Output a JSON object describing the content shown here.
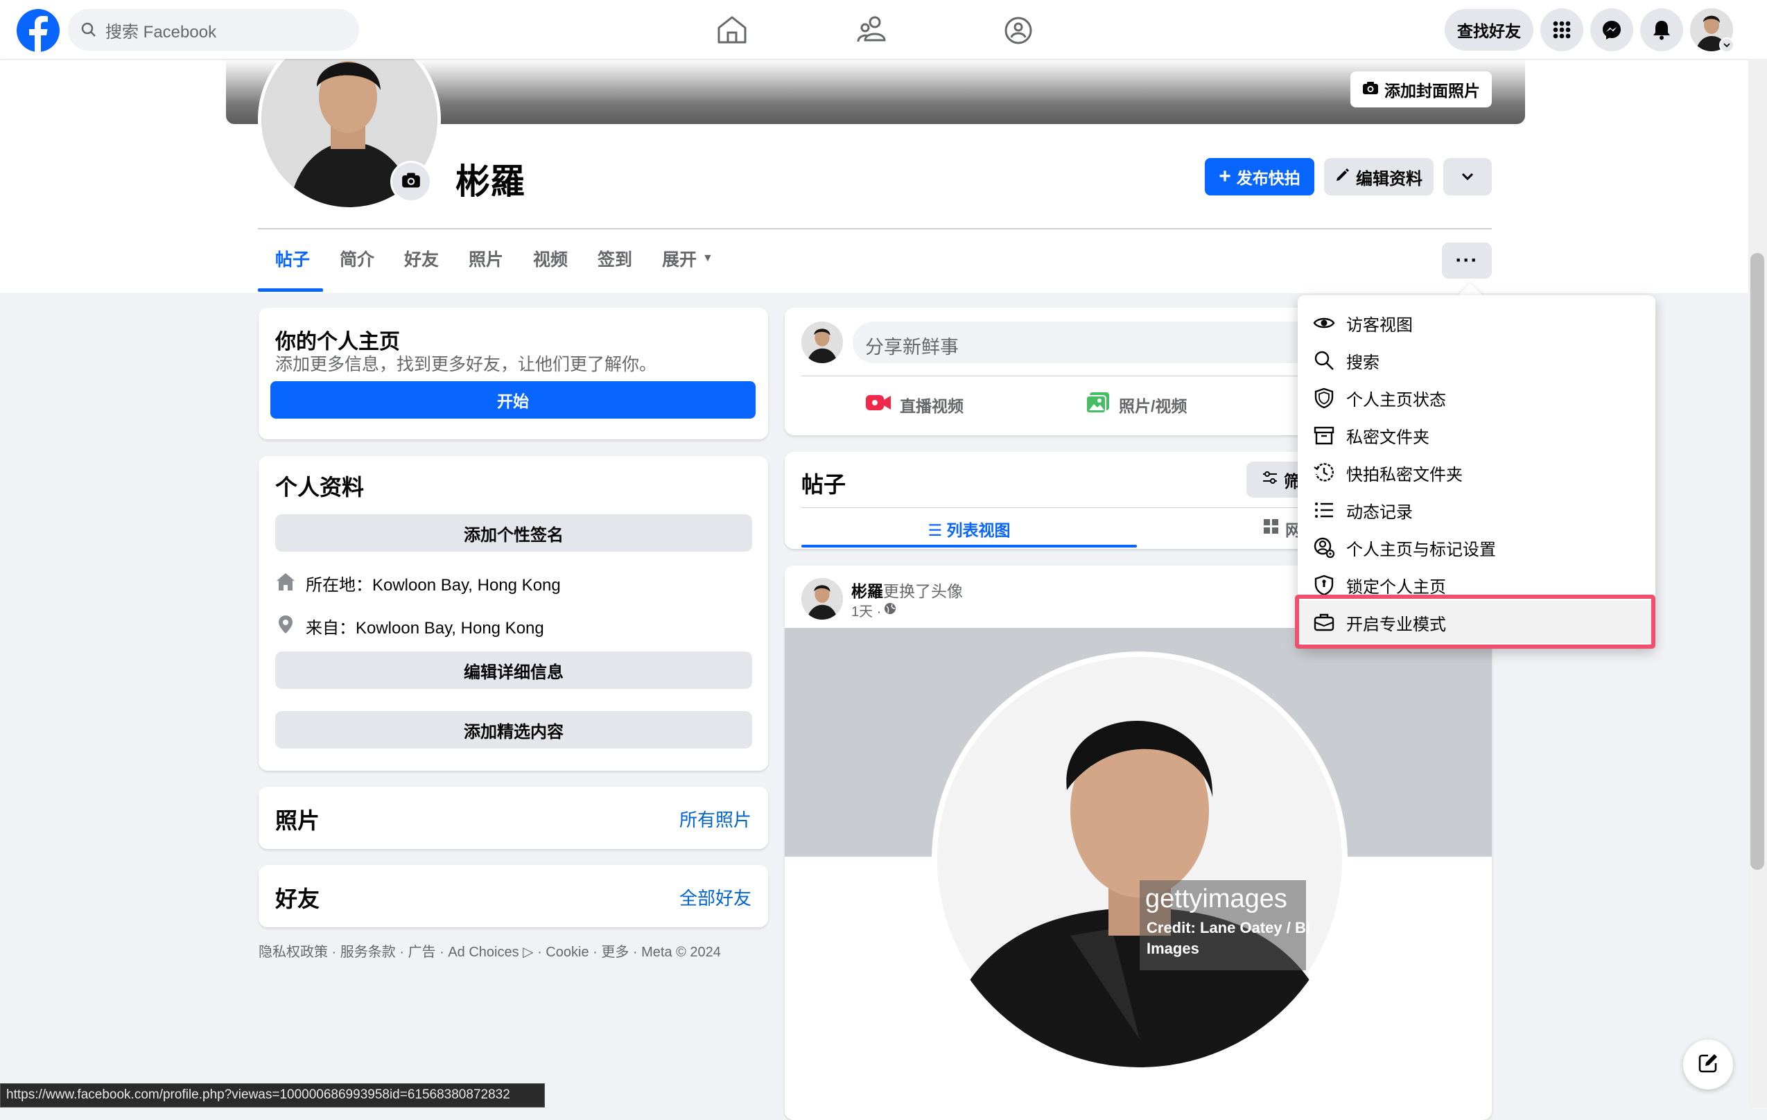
{
  "topbar": {
    "search_placeholder": "搜索 Facebook",
    "find_friends": "查找好友"
  },
  "profile": {
    "name": "彬羅",
    "add_cover": "添加封面照片",
    "post_story": "发布快拍",
    "edit_profile": "编辑资料"
  },
  "tabs": [
    "帖子",
    "简介",
    "好友",
    "照片",
    "视频",
    "签到",
    "展开"
  ],
  "intro_card": {
    "title": "你的个人主页",
    "subtitle": "添加更多信息，找到更多好友，让他们更了解你。",
    "start": "开始"
  },
  "details": {
    "title": "个人资料",
    "add_bio": "添加个性签名",
    "lives_in": "所在地：Kowloon Bay, Hong Kong",
    "from": "来自：Kowloon Bay, Hong Kong",
    "edit_details": "编辑详细信息",
    "add_featured": "添加精选内容"
  },
  "photos_card": {
    "title": "照片",
    "link": "所有照片"
  },
  "friends_card": {
    "title": "好友",
    "link": "全部好友"
  },
  "footer": "隐私权政策 · 服务条款 · 广告 · Ad Choices ▷ · Cookie · 更多 · Meta © 2024",
  "composer": {
    "placeholder": "分享新鲜事",
    "live": "直播视频",
    "photo": "照片/视频"
  },
  "posts_header": {
    "title": "帖子",
    "filter": "筛",
    "list_view": "☰ 列表视图",
    "grid_view": "网"
  },
  "post": {
    "author": "彬羅",
    "action": "更换了头像",
    "time": "1天 ·",
    "watermark_brand": "gettyimages",
    "watermark_credit": "Credit: Lane Oatey / Bl",
    "watermark_credit2": "Images"
  },
  "menu": {
    "items": [
      {
        "label": "访客视图",
        "icon": "eye-icon"
      },
      {
        "label": "搜索",
        "icon": "search-icon"
      },
      {
        "label": "个人主页状态",
        "icon": "shield-icon"
      },
      {
        "label": "私密文件夹",
        "icon": "archive-icon"
      },
      {
        "label": "快拍私密文件夹",
        "icon": "history-icon"
      },
      {
        "label": "动态记录",
        "icon": "list-icon"
      },
      {
        "label": "个人主页与标记设置",
        "icon": "user-gear-icon"
      },
      {
        "label": "锁定个人主页",
        "icon": "lock-shield-icon"
      },
      {
        "label": "开启专业模式",
        "icon": "briefcase-icon"
      }
    ],
    "highlight_color": "#f0506e"
  },
  "status_url": "https://www.facebook.com/profile.php?viewas=100000686993958id=61568380872832",
  "colors": {
    "brand": "#0866ff",
    "link": "#0064d1"
  }
}
